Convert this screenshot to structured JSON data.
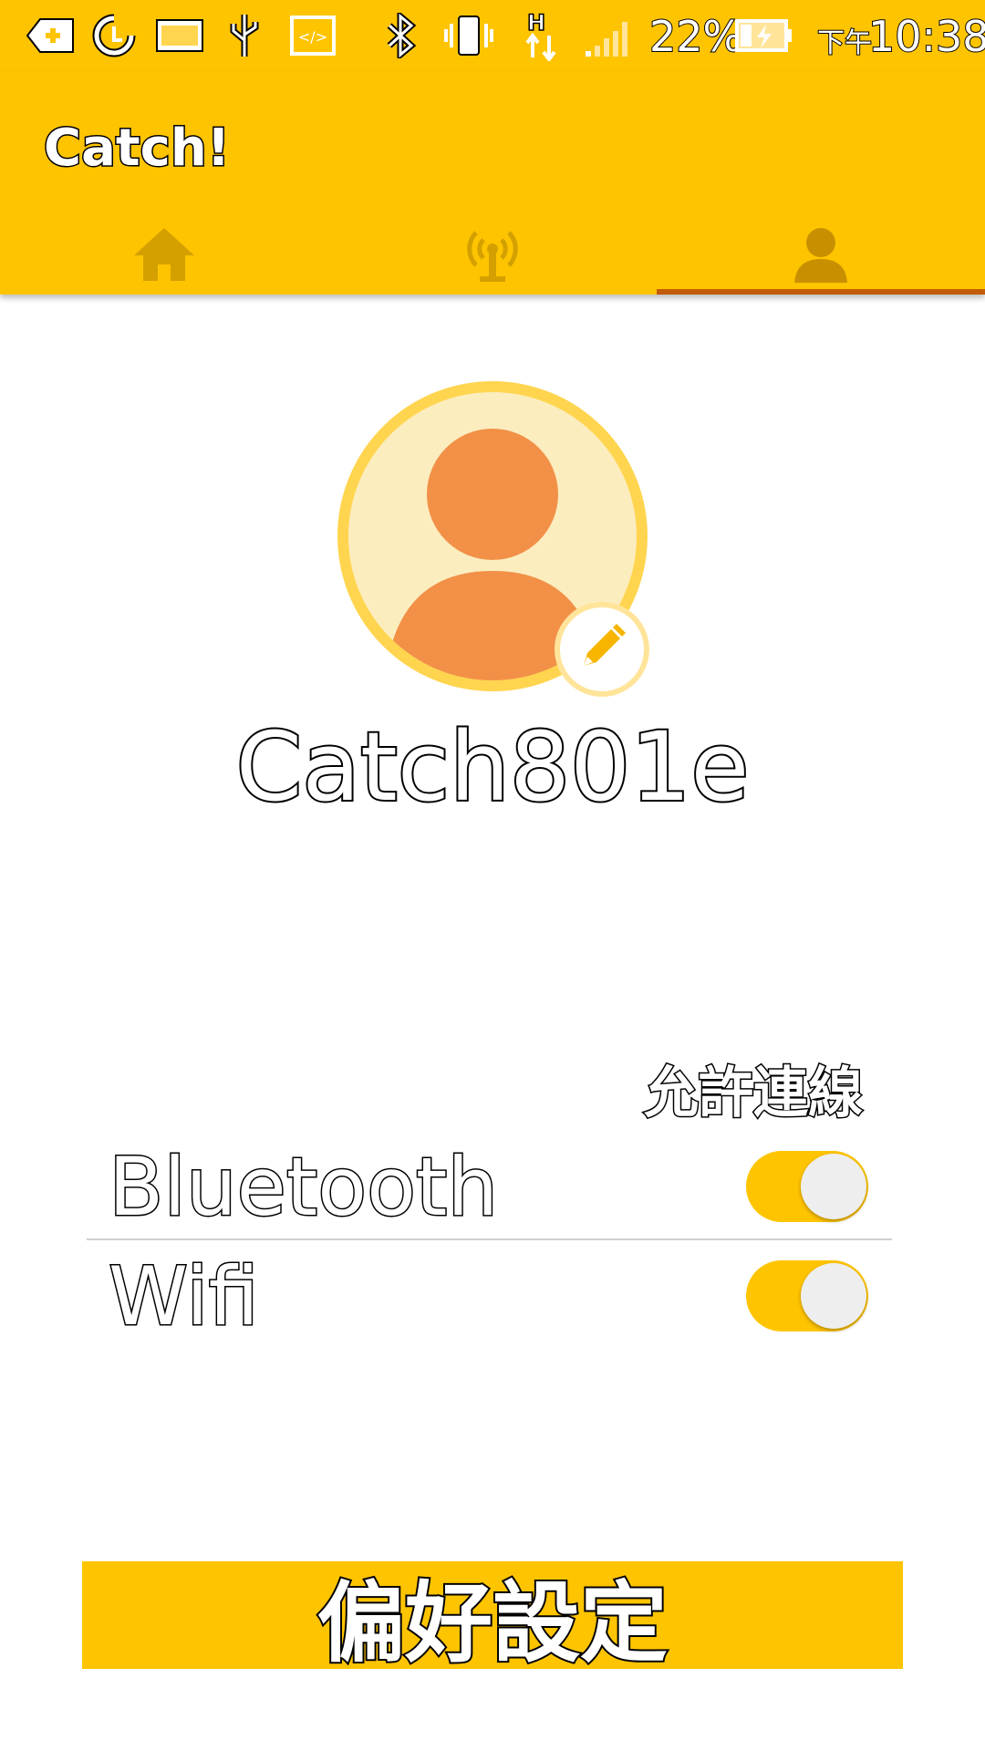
{
  "status_bar": {
    "battery_percent": "22%",
    "ampm": "下午",
    "time": "10:38",
    "icons": [
      "add-notification-icon",
      "sync-icon",
      "image-icon",
      "usb-icon",
      "developer-code-icon",
      "bluetooth-icon",
      "vibrate-icon",
      "hspa-data-icon",
      "signal-icon",
      "battery-charging-icon"
    ]
  },
  "app_bar": {
    "title": "Catch!",
    "tabs": [
      {
        "icon": "home-icon",
        "selected": false
      },
      {
        "icon": "antenna-icon",
        "selected": false
      },
      {
        "icon": "person-icon",
        "selected": true
      }
    ]
  },
  "profile": {
    "username": "Catch801e",
    "avatar_icon": "person-avatar-icon",
    "edit_icon": "pencil-icon"
  },
  "connections": {
    "heading": "允許連線",
    "items": [
      {
        "label": "Bluetooth",
        "enabled": true
      },
      {
        "label": "Wifi",
        "enabled": true
      }
    ]
  },
  "preferences_button": {
    "label": "偏好設定"
  },
  "colors": {
    "primary": "#FFC400",
    "accent_indicator": "#C25B0A",
    "avatar_bg": "#FCEDBF",
    "avatar_ring": "#FFD54F",
    "avatar_figure": "#F29047"
  }
}
